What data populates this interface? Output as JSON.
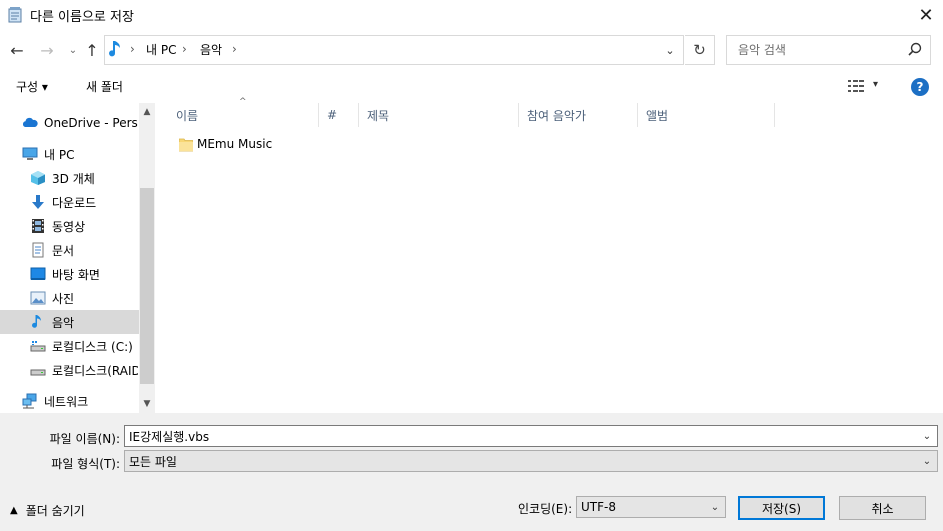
{
  "window": {
    "title": "다른 이름으로 저장",
    "close_glyph": "✕"
  },
  "nav": {
    "back_glyph": "←",
    "forward_glyph": "→",
    "recent_glyph": "⌄",
    "up_glyph": "↑",
    "breadcrumbs": [
      "내 PC",
      "음악"
    ],
    "sep_glyph": "›",
    "dropdown_glyph": "⌄",
    "refresh_glyph": "↻",
    "search_placeholder": "음악 검색"
  },
  "toolbar": {
    "organize_label": "구성 ▾",
    "new_folder_label": "새 폴더",
    "view_dd_glyph": "▾",
    "help_label": "?"
  },
  "sidebar": {
    "items": [
      {
        "label": "OneDrive - Personal",
        "icon": "cloud-icon"
      },
      {
        "label": "내 PC",
        "icon": "computer-icon"
      },
      {
        "label": "3D 개체",
        "icon": "cube-icon"
      },
      {
        "label": "다운로드",
        "icon": "download-icon"
      },
      {
        "label": "동영상",
        "icon": "film-icon"
      },
      {
        "label": "문서",
        "icon": "document-icon"
      },
      {
        "label": "바탕 화면",
        "icon": "desktop-icon"
      },
      {
        "label": "사진",
        "icon": "picture-icon"
      },
      {
        "label": "음악",
        "icon": "music-icon",
        "selected": true
      },
      {
        "label": "로컬디스크 (C:)",
        "icon": "drive-icon"
      },
      {
        "label": "로컬디스크(RAID)",
        "icon": "drive-icon"
      },
      {
        "label": "네트워크",
        "icon": "network-icon"
      }
    ],
    "scroll_up_glyph": "▲",
    "scroll_down_glyph": "▼"
  },
  "list": {
    "columns": [
      "이름",
      "#",
      "제목",
      "참여 음악가",
      "앨범"
    ],
    "sort_glyph": "^",
    "files": [
      {
        "name": "MEmu Music",
        "type": "folder"
      }
    ]
  },
  "form": {
    "filename_label": "파일 이름(N):",
    "filename_value": "IE강제실행.vbs",
    "filetype_label": "파일 형식(T):",
    "filetype_value": "모든 파일",
    "dd_glyph": "⌄",
    "hide_folders_label": "폴더 숨기기",
    "hide_glyph": "▲",
    "encoding_label": "인코딩(E):",
    "encoding_value": "UTF-8",
    "save_label": "저장(S)",
    "cancel_label": "취소"
  },
  "colors": {
    "accent": "#0078d7",
    "help": "#1c6fc4",
    "column_header": "#4c607a",
    "folder": "#f8d775"
  }
}
